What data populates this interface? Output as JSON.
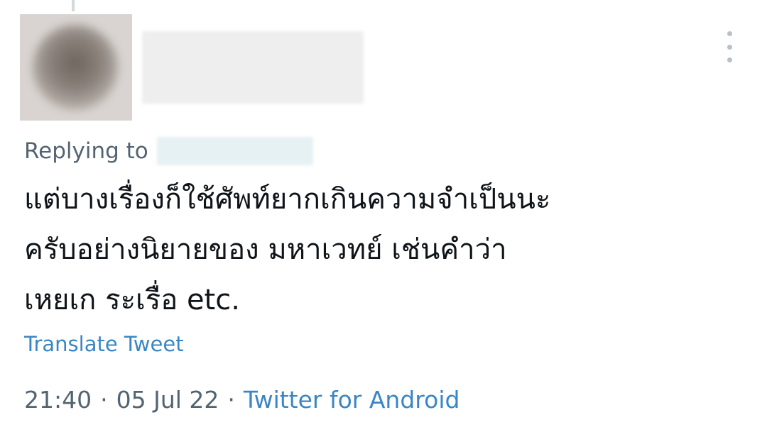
{
  "tweet": {
    "reply_prefix": "Replying to",
    "text": "แต่บางเรื่องก็ใช้ศัพท์ยากเกินความจำเป็นนะ\nครับอย่างนิยายของ มหาเวทย์ เช่นคำว่า\nเหยเก ระเรื่อ etc.",
    "translate_label": "Translate Tweet",
    "time": "21:40",
    "date": "05 Jul 22",
    "separator": "·",
    "source": "Twitter for Android"
  },
  "icons": {
    "more": "more-vertical-icon"
  },
  "colors": {
    "link": "#3a86c4",
    "secondary_text": "#536471",
    "primary_text": "#0f1419"
  }
}
